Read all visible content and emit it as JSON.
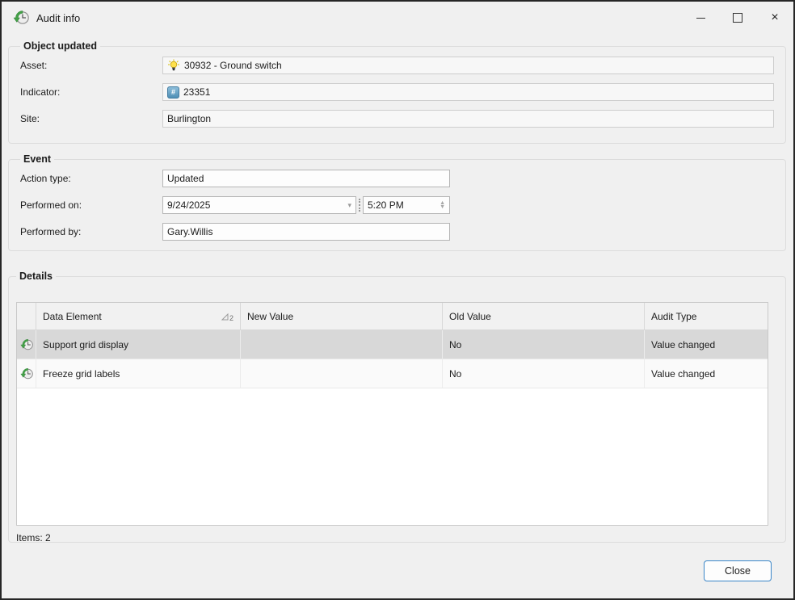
{
  "window": {
    "title": "Audit info",
    "controls": [
      {
        "name": "minimize"
      },
      {
        "name": "maximize"
      },
      {
        "name": "close"
      }
    ]
  },
  "object_updated": {
    "legend": "Object updated",
    "fields": [
      {
        "label": "Asset:",
        "value": "30932 - Ground switch",
        "icon": "lightbulb-icon"
      },
      {
        "label": "Indicator:",
        "value": "23351",
        "icon": "hash-badge-icon"
      },
      {
        "label": "Site:",
        "value": "Burlington",
        "icon": ""
      }
    ]
  },
  "event": {
    "legend": "Event",
    "fields": [
      {
        "label": "Action type:",
        "value": "Updated"
      },
      {
        "label": "Performed on:",
        "date": "9/24/2025",
        "time": "5:20 PM"
      },
      {
        "label": "Performed by:",
        "value": "Gary.Willis"
      }
    ]
  },
  "details": {
    "legend": "Details",
    "table": {
      "columns": [
        "Data Element",
        "New Value",
        "Old Value",
        "Audit Type"
      ],
      "sort_badge": "2",
      "row_icon": "audit-clock-icon",
      "rows": [
        {
          "data_element": "Support grid display",
          "new_value": "",
          "old_value": "No",
          "audit_type": "Value changed"
        },
        {
          "data_element": "Freeze grid labels",
          "new_value": "",
          "old_value": "No",
          "audit_type": "Value changed"
        }
      ]
    },
    "items_text": "Items: 2"
  },
  "footer": {
    "close_label": "Close"
  },
  "icons": {
    "titlebar": "audit-clock-icon",
    "asset": "lightbulb-icon",
    "indicator": "hash-badge-icon",
    "sort": "sort-ascending-icon"
  },
  "colors": {
    "window_bg": "#f0f0f0",
    "accent": "#3a86c8",
    "selection": "#d8d8d8",
    "icon_green": "#43a047",
    "icon_yellow": "#ffe14d",
    "icon_blue": "#4f8fb5"
  }
}
